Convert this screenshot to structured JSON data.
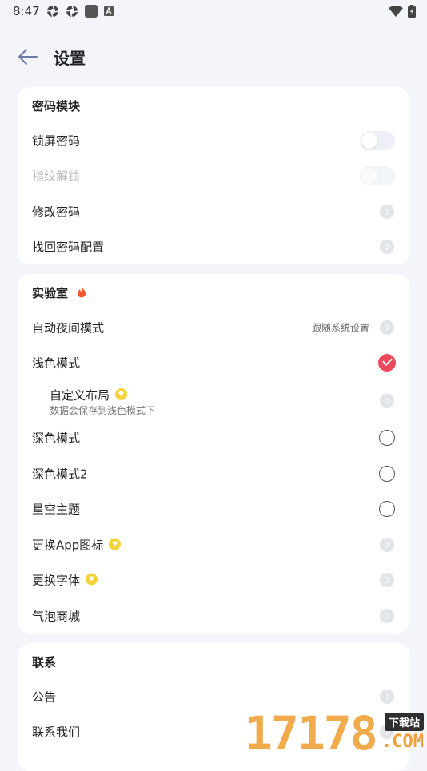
{
  "status_bar": {
    "time": "8:47"
  },
  "header": {
    "title": "设置"
  },
  "password_section": {
    "title": "密码模块",
    "items": [
      {
        "label": "锁屏密码",
        "control": "toggle",
        "on": false
      },
      {
        "label": "指纹解锁",
        "control": "toggle",
        "on": false,
        "disabled": true
      },
      {
        "label": "修改密码",
        "control": "chevron"
      },
      {
        "label": "找回密码配置",
        "control": "chevron"
      }
    ]
  },
  "lab_section": {
    "title": "实验室",
    "items": [
      {
        "label": "自动夜间模式",
        "value": "跟随系统设置",
        "control": "chevron"
      },
      {
        "label": "浅色模式",
        "control": "radio",
        "checked": true
      },
      {
        "label": "自定义布局",
        "sub": "数据会保存到浅色模式下",
        "badge": "vip",
        "control": "chevron"
      },
      {
        "label": "深色模式",
        "control": "radio",
        "checked": false
      },
      {
        "label": "深色模式2",
        "control": "radio",
        "checked": false
      },
      {
        "label": "星空主题",
        "control": "radio",
        "checked": false
      },
      {
        "label": "更换App图标",
        "badge": "vip",
        "control": "chevron"
      },
      {
        "label": "更换字体",
        "badge": "vip",
        "control": "chevron"
      },
      {
        "label": "气泡商城",
        "control": "chevron"
      }
    ]
  },
  "contact_section": {
    "title": "联系",
    "items": [
      {
        "label": "公告",
        "control": "chevron"
      },
      {
        "label": "联系我们",
        "control": "chevron"
      }
    ]
  },
  "watermark": {
    "digits": "17178",
    "badge": "下载站",
    "domain": ".COM"
  },
  "colors": {
    "accent": "#ec4a5b",
    "vip": "#f6d23a",
    "background": "#f4f5fa",
    "flame": "#f05a28"
  },
  "icons": [
    "back-arrow-icon",
    "flame-icon",
    "vip-diamond-icon",
    "chevron-right-icon",
    "checkmark-icon",
    "wifi-icon",
    "battery-icon"
  ]
}
